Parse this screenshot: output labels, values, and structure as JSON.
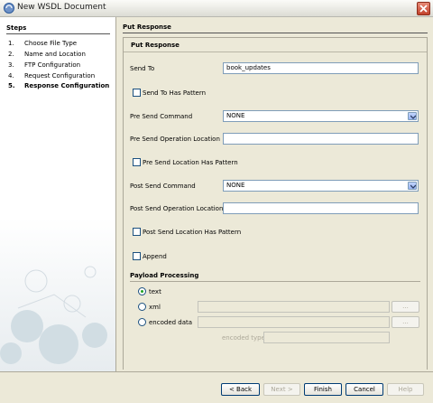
{
  "window": {
    "title": "New WSDL Document"
  },
  "steps": {
    "header": "Steps",
    "items": [
      {
        "num": "1.",
        "label": "Choose File Type"
      },
      {
        "num": "2.",
        "label": "Name and Location"
      },
      {
        "num": "3.",
        "label": "FTP Configuration"
      },
      {
        "num": "4.",
        "label": "Request Configuration"
      },
      {
        "num": "5.",
        "label": "Response Configuration"
      }
    ],
    "current_index": 4
  },
  "main": {
    "header": "Put Response",
    "box_title": "Put Response",
    "send_to": {
      "label": "Send To",
      "value": "book_updates"
    },
    "send_to_has_pattern": {
      "label": "Send To Has Pattern",
      "checked": false
    },
    "pre_send_command": {
      "label": "Pre Send Command",
      "value": "NONE"
    },
    "pre_send_operation_location": {
      "label": "Pre Send Operation Location",
      "value": ""
    },
    "pre_send_location_has_pattern": {
      "label": "Pre Send Location Has Pattern",
      "checked": false
    },
    "post_send_command": {
      "label": "Post Send Command",
      "value": "NONE"
    },
    "post_send_operation_location": {
      "label": "Post Send Operation Location",
      "value": ""
    },
    "post_send_location_has_pattern": {
      "label": "Post Send Location Has Pattern",
      "checked": false
    },
    "append": {
      "label": "Append",
      "checked": false
    },
    "payload": {
      "title": "Payload Processing",
      "options": [
        {
          "label": "text",
          "selected": true
        },
        {
          "label": "xml",
          "selected": false
        },
        {
          "label": "encoded data",
          "selected": false
        }
      ],
      "browse_label": "...",
      "encoded_type_label": "encoded type:"
    }
  },
  "buttons": {
    "back": "< Back",
    "next": "Next >",
    "finish": "Finish",
    "cancel": "Cancel",
    "help": "Help"
  },
  "colors": {
    "panel_bg": "#ece9d8",
    "field_border": "#7f9db9",
    "selected_radio": "#21a121"
  }
}
